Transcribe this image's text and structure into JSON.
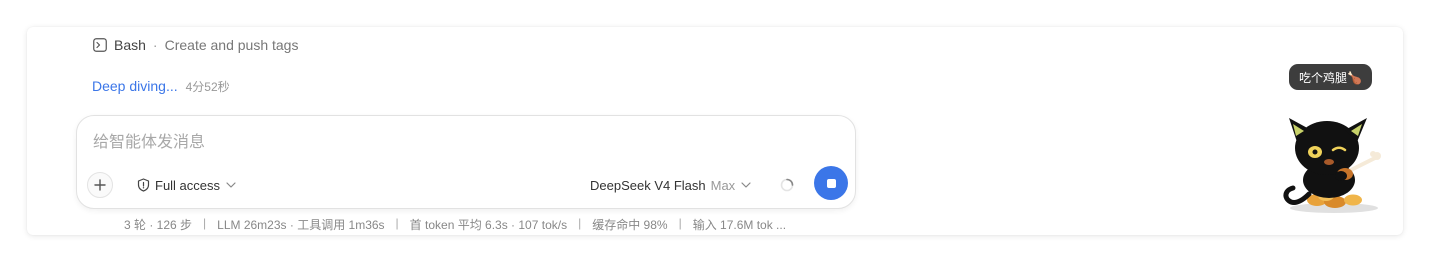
{
  "tool_call": {
    "tool_name": "Bash",
    "separator": "·",
    "description": "Create and push tags",
    "icon": "terminal-icon"
  },
  "status": {
    "text": "Deep diving...",
    "elapsed": "4分52秒",
    "color": "#3b76e8"
  },
  "composer": {
    "placeholder": "给智能体发消息",
    "value": "",
    "add_icon": "plus-icon",
    "access": {
      "label": "Full access",
      "icon": "shield-icon"
    },
    "model": {
      "name": "DeepSeek V4 Flash",
      "mode": "Max"
    },
    "stop_icon": "stop-icon",
    "accent": "#3b76e8"
  },
  "stats": {
    "turns": "3 轮 · 126 步",
    "llm": "LLM 26m23s · 工具调用 1m36s",
    "first_token": "首 token 平均 6.3s · 107 tok/s",
    "cache": "缓存命中 98%",
    "input": "输入 17.6M tok ...",
    "divider": "|"
  },
  "mascot": {
    "speech": "吃个鸡腿🍗",
    "icon": "black-cat-mascot-icon"
  }
}
